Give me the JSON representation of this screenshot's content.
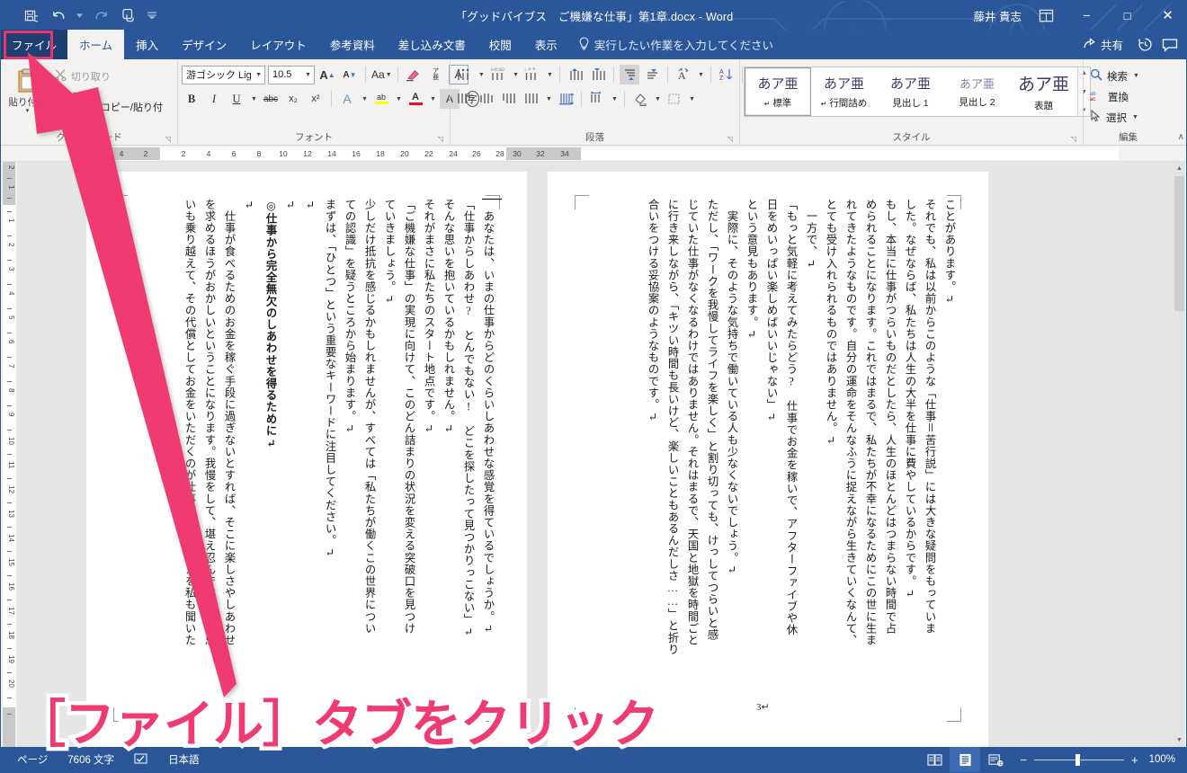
{
  "window": {
    "document_title": "「グッドバイブス　ご機嫌な仕事」第1章.docx  -  Word",
    "user_name": "藤井 貴志",
    "minimize": "−",
    "maximize": "□",
    "close": "✕"
  },
  "quick_access": [
    {
      "name": "save-icon",
      "glyph": "save"
    },
    {
      "name": "undo-icon",
      "glyph": "undo"
    },
    {
      "name": "redo-icon",
      "glyph": "redo"
    },
    {
      "name": "touch-mode-icon",
      "glyph": "touch"
    },
    {
      "name": "customize-qat-icon",
      "glyph": "caret"
    }
  ],
  "tabs": {
    "file": "ファイル",
    "items": [
      "ホーム",
      "挿入",
      "デザイン",
      "レイアウト",
      "参考資料",
      "差し込み文書",
      "校閲",
      "表示"
    ],
    "active": "ホーム",
    "tell_me": "実行したい作業を入力してください",
    "share": "共有"
  },
  "ribbon": {
    "clipboard": {
      "label": "クリップボード",
      "paste": "貼り付け",
      "cut": "切り取り",
      "copy": "コピー",
      "format_painter": "書式のコピー/貼り付け"
    },
    "font": {
      "label": "フォント",
      "font_name": "游ゴシック Ligh",
      "font_size": "10.5",
      "bold": "B",
      "italic": "I",
      "underline": "U",
      "strikethrough": "abc",
      "subscript": "x₂",
      "superscript": "x²",
      "grow_font": "A",
      "shrink_font": "A",
      "change_case": "Aa",
      "clear_formatting": "clear",
      "phonetic_guide": "ア亜",
      "char_border": "A",
      "text_effects": "A",
      "highlight": "ab",
      "font_color": "A",
      "shading_char": "A",
      "enclose_char": "字"
    },
    "paragraph": {
      "label": "段落",
      "bullets": "bullets",
      "numbering": "numbering",
      "multilevel": "multilevel",
      "decrease_indent": "decrease-indent",
      "increase_indent": "increase-indent",
      "align_top": "align-top",
      "align_bottom": "align-bottom",
      "asian_layout": "asian-layout",
      "sort": "sort",
      "show_marks": "show-marks",
      "align_right": "align-right",
      "align_center": "align-center",
      "distributed": "distributed",
      "justify": "justify",
      "line_spacing": "line-spacing",
      "grid_settings": "grid-settings",
      "shading": "shading",
      "borders": "borders"
    },
    "styles": {
      "label": "スタイル",
      "items": [
        {
          "sample": "あア亜",
          "name": "標準",
          "pilcrow": true,
          "selected": true
        },
        {
          "sample": "あア亜",
          "name": "行間詰め",
          "pilcrow": true,
          "selected": false
        },
        {
          "sample": "あア亜",
          "name": "見出し 1",
          "pilcrow": false,
          "selected": false
        },
        {
          "sample": "あア亜",
          "name": "見出し 2",
          "pilcrow": false,
          "selected": false
        },
        {
          "sample": "あア亜",
          "name": "表題",
          "pilcrow": false,
          "selected": false
        }
      ]
    },
    "editing": {
      "label": "編集",
      "find": "検索",
      "replace": "置換",
      "select": "選択"
    },
    "collapse": "∧"
  },
  "ruler": {
    "horizontal_gray_left": [
      "6",
      "4",
      "2"
    ],
    "horizontal_white": [
      "2",
      "4",
      "6",
      "8",
      "10",
      "12",
      "14",
      "16",
      "18",
      "20",
      "22",
      "24",
      "26",
      "28"
    ],
    "horizontal_gray_right": [
      "30",
      "32",
      "34"
    ],
    "vertical_top_gray": [
      "2",
      "1"
    ],
    "vertical_white": [
      "1",
      "2",
      "3",
      "4",
      "5",
      "6",
      "7",
      "8",
      "9",
      "10",
      "11",
      "12",
      "13",
      "14",
      "15",
      "16",
      "17",
      "18",
      "19",
      "20"
    ]
  },
  "document": {
    "page_number": "3↵",
    "left_page_columns": [
      "いも乗り越えて、その代償としてお金をいただくのが仕事。そんな教えを私も聞いた",
      "を求めるほうがおかしいということになります。我慢をして、堪え忍んで、つらい思",
      "　仕事が食べるためのお金を稼ぐ手段に過ぎないとすれば、そこに楽しさやしあわせ",
      "↵",
      "◎仕事から完全無欠のしあわせを得るために↵",
      "↵",
      "↵",
      "まずは、「ひとつ」という重要なキーワードに注目してください。↵",
      "ての認識」を疑うところから始まります。↵",
      "少しだけ抵抗を感じるかもしれませんが、すべては「私たちが働くこの世界につい",
      "ていきましょう。↵",
      "「ご機嫌な仕事」の実現に向けて、このどん詰まりの状況を変える突破口を見つけ",
      "それがまさに私たちのスタート地点です。↵",
      "そんな思いを抱いているかもしれません。↵",
      "「仕事からしあわせ?　とんでもない!　どこを探したって見つかりっこない」↵",
      "　あなたは、いまの仕事からどのくらいしあわせな感覚を得ているでしょうか。↵"
    ],
    "right_page_columns": [
      "合いをつける妥協案のようなものです。↵",
      "に行き来しながら、「キツい時間も長いけど、楽しいこともあるんだしさ……」と折り",
      "じていた仕事がなくなるわけではありません。それはまるで、天国と地獄を時間ごと",
      "ただし、「ワークを我慢してライフを楽しく」と割り切っても、けっしてつらいと感",
      "　実際に、そのような気持ちで働いている人も少なくないでしょう。↵",
      "という意見もあります。↵",
      "日をめいっぱい楽しめばいいじゃない」↵",
      "「もっと気軽に考えてみたらどう?　仕事でお金を稼いで、アフターファイブや休",
      "　一方で、↵",
      "とても受け入れられるものではありません。↵",
      "れてきたようなものです。自分の運命をそんなふうに捉えながら生きていくなんて、",
      "められることになります。これではまるで、私たちが不幸になるためにこの世に生ま",
      "もし、本当に仕事がつらいものだとしたら、人生のほとんどはつまらない時間で占",
      "した。なぜならば、私たちは人生の大半を仕事に費やしているからです。↵",
      "それでも、私は以前からこのような「仕事＝苦行説」には大きな疑問をもっていま",
      "ことがあります。↵"
    ]
  },
  "status_bar": {
    "page_info": "ページ",
    "char_count": "7606 文字",
    "proofing_icon": "proofing",
    "language": "日本語",
    "views": [
      "read-mode",
      "print-layout",
      "web-layout"
    ],
    "active_view": "print-layout",
    "zoom_out": "−",
    "zoom_in": "+",
    "zoom_level": "100%"
  },
  "annotation": {
    "callout_text": "［ファイル］タブをクリック",
    "accent_color": "#ef3b72",
    "arrow_target": "file-tab"
  }
}
